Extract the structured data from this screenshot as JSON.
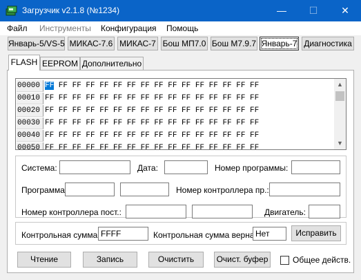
{
  "window": {
    "title": "Загрузчик v2.1.8 (№1234)",
    "min_glyph": "—",
    "max_glyph": "☐",
    "close_glyph": "✕"
  },
  "menu": [
    "Файл",
    "Инструменты",
    "Конфигурация",
    "Помощь"
  ],
  "toolbar": [
    "Январь-5/VS-5",
    "МИКАС-7.6",
    "МИКАС-7",
    "Бош МП7.0",
    "Бош М7.9.7",
    "Январь-7",
    "Диагностика"
  ],
  "tabs": [
    "FLASH",
    "EEPROM",
    "Дополнительно"
  ],
  "hex": {
    "addresses": [
      "00000",
      "00010",
      "00020",
      "00030",
      "00040",
      "00050"
    ],
    "bytes": "FF FF FF FF FF FF FF FF FF FF FF FF FF FF FF FF",
    "first_byte": "FF",
    "rest_bytes": " FF FF FF FF FF FF FF FF FF FF FF FF FF FF FF",
    "scroll_up": "▲",
    "scroll_down": "▼"
  },
  "info": {
    "system_label": "Система:",
    "system_value": "",
    "date_label": "Дата:",
    "date_value": "",
    "prog_num_label": "Номер программы:",
    "prog_num_value": "",
    "program_label": "Программа:",
    "program_value_1": "",
    "program_value_2": "",
    "ctrl_num_label": "Номер контроллера пр.:",
    "ctrl_num_value": "",
    "ctrl_const_label": "Номер контроллера пост.:",
    "ctrl_const_value_1": "",
    "ctrl_const_value_2": "",
    "engine_label": "Двигатель:",
    "engine_value": ""
  },
  "checksum": {
    "label": "Контрольная сумма:",
    "value": "FFFF",
    "ok_label": "Контрольная сумма верна:",
    "ok_value": "Нет",
    "fix_button": "Исправить"
  },
  "actions": {
    "read": "Чтение",
    "write": "Запись",
    "clear": "Очистить",
    "clear_buffer": "Очист. буфер",
    "common_label": "Общее действ.",
    "common_checked": false
  }
}
